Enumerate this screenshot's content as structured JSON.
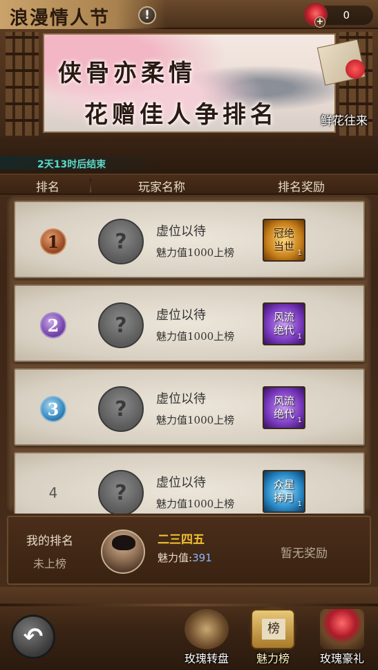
{
  "header": {
    "title": "浪漫情人节",
    "info_icon": "!",
    "rose_count": "0",
    "rose_plus": "+"
  },
  "banner": {
    "slogan_line1": "侠骨亦柔情",
    "slogan_line2": "花赠佳人争排名",
    "flower_letter_label": "鲜花往来"
  },
  "countdown": "2天13时后结束",
  "columns": {
    "rank": "排名",
    "player": "玩家名称",
    "reward": "排名奖励"
  },
  "rows": [
    {
      "rank": "1",
      "name": "虚位以待",
      "requirement": "魅力值1000上榜",
      "reward": "冠绝当世",
      "reward_count": "1"
    },
    {
      "rank": "2",
      "name": "虚位以待",
      "requirement": "魅力值1000上榜",
      "reward": "风流绝代",
      "reward_count": "1"
    },
    {
      "rank": "3",
      "name": "虚位以待",
      "requirement": "魅力值1000上榜",
      "reward": "风流绝代",
      "reward_count": "1"
    },
    {
      "rank": "4",
      "name": "虚位以待",
      "requirement": "魅力值1000上榜",
      "reward": "众星捧月",
      "reward_count": "1"
    }
  ],
  "avatar_placeholder": "?",
  "my_rank": {
    "label": "我的排名",
    "value": "未上榜",
    "player_name": "二三四五",
    "charm_label": "魅力值:",
    "charm_value": "391",
    "reward_status": "暂无奖励"
  },
  "nav": {
    "back": "↶",
    "items": [
      {
        "label": "玫瑰转盘"
      },
      {
        "label": "魅力榜"
      },
      {
        "label": "玫瑰豪礼"
      }
    ]
  }
}
